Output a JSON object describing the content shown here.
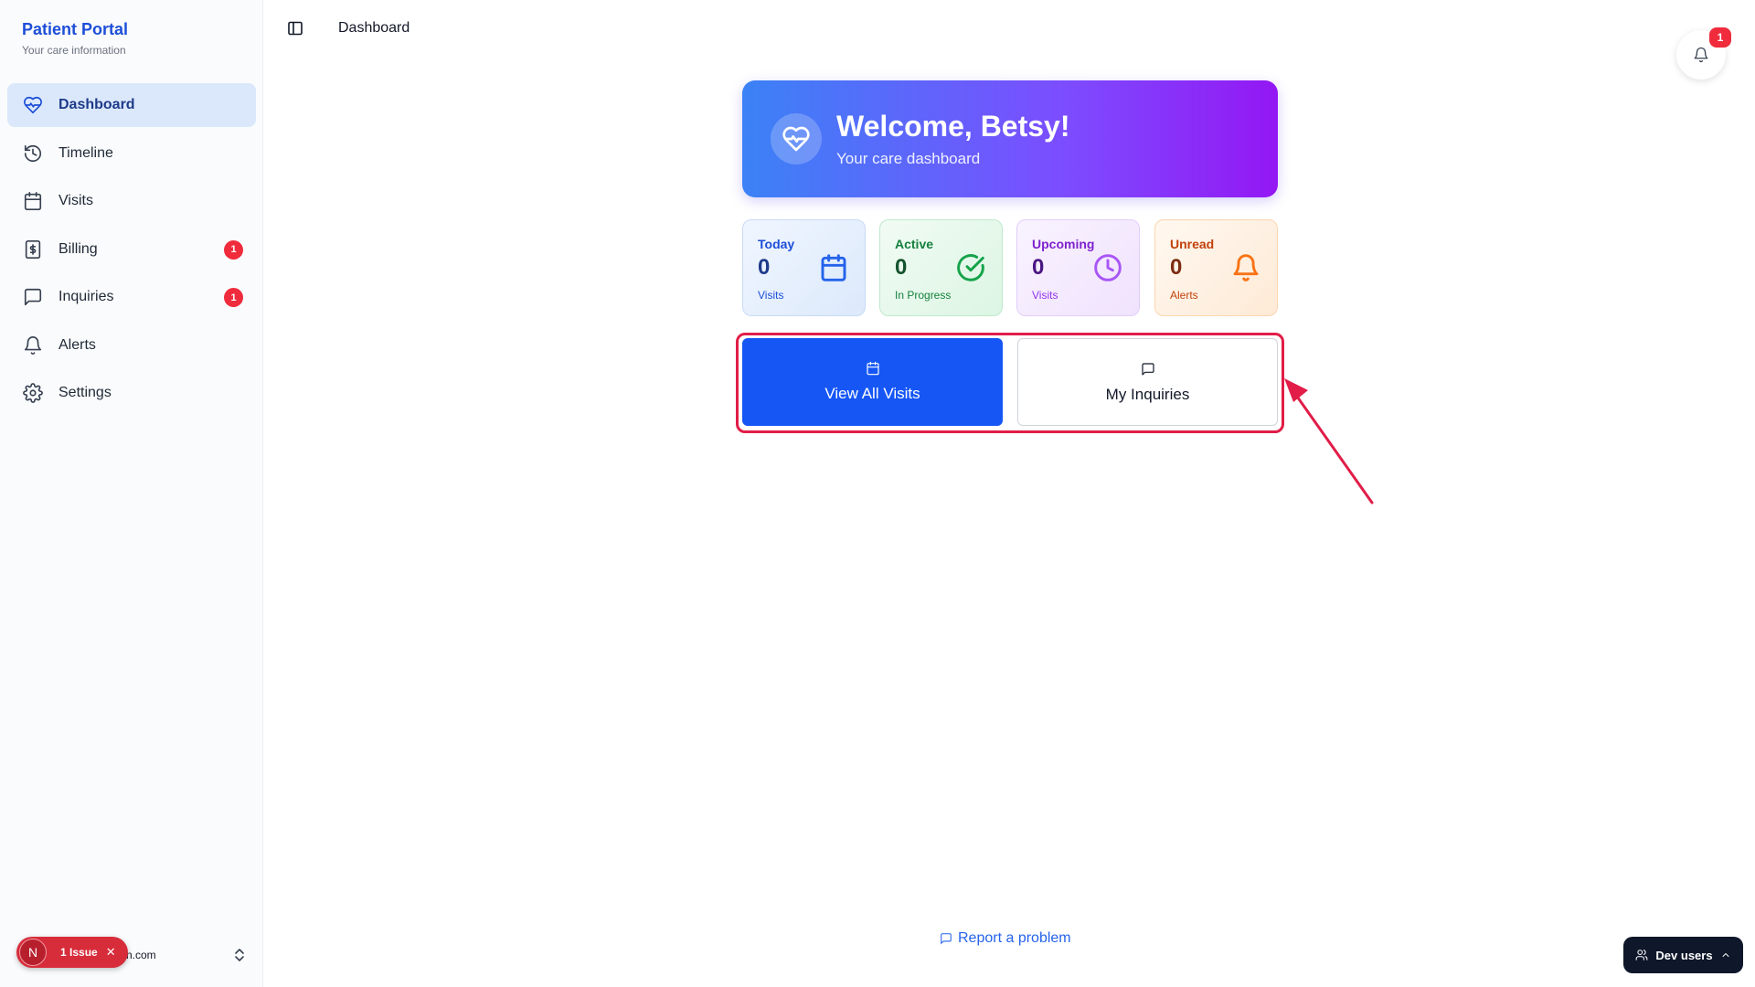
{
  "sidebar": {
    "brand_title": "Patient Portal",
    "brand_subtitle": "Your care information",
    "items": [
      {
        "label": "Dashboard",
        "icon": "heart-pulse-icon",
        "active": true
      },
      {
        "label": "Timeline",
        "icon": "history-icon"
      },
      {
        "label": "Visits",
        "icon": "calendar-icon"
      },
      {
        "label": "Billing",
        "icon": "dollar-receipt-icon",
        "badge": "1"
      },
      {
        "label": "Inquiries",
        "icon": "message-square-icon",
        "badge": "1"
      },
      {
        "label": "Alerts",
        "icon": "bell-icon"
      },
      {
        "label": "Settings",
        "icon": "gear-icon"
      }
    ],
    "footer_email": "n.com",
    "issue_badge": {
      "letter": "N",
      "text": "1 Issue",
      "close": "✕"
    }
  },
  "header": {
    "title": "Dashboard",
    "notification_count": "1"
  },
  "welcome": {
    "title": "Welcome, Betsy!",
    "subtitle": "Your care dashboard"
  },
  "stats": [
    {
      "label": "Today",
      "value": "0",
      "sub": "Visits",
      "icon": "calendar-icon",
      "color": "#2563eb"
    },
    {
      "label": "Active",
      "value": "0",
      "sub": "In Progress",
      "icon": "check-circle-icon",
      "color": "#16a34a"
    },
    {
      "label": "Upcoming",
      "value": "0",
      "sub": "Visits",
      "icon": "clock-icon",
      "color": "#a855f7"
    },
    {
      "label": "Unread",
      "value": "0",
      "sub": "Alerts",
      "icon": "bell-icon",
      "color": "#f97316"
    }
  ],
  "actions": {
    "view_visits": "View All Visits",
    "my_inquiries": "My Inquiries"
  },
  "annotation_color": "#e11d48",
  "footer": {
    "report_problem": "Report a problem",
    "dev_users": "Dev users"
  }
}
